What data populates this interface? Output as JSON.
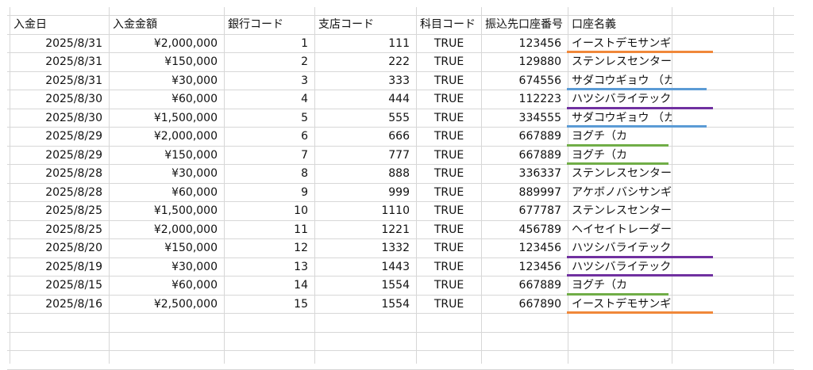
{
  "sheet": {
    "headers": [
      "入金日",
      "入金金額",
      "銀行コード",
      "支店コード",
      "科目コード",
      "振込先口座番号",
      "口座名義"
    ],
    "rows": [
      [
        "2025/8/31",
        "¥2,000,000",
        "1",
        "111",
        "TRUE",
        "123456",
        "イーストデモサンギョウ（カ"
      ],
      [
        "2025/8/31",
        "¥150,000",
        "2",
        "222",
        "TRUE",
        "129880",
        "ステンレスセンター （カ"
      ],
      [
        "2025/8/31",
        "¥30,000",
        "3",
        "333",
        "TRUE",
        "674556",
        "サダコウギョウ （カ"
      ],
      [
        "2025/8/30",
        "¥60,000",
        "4",
        "444",
        "TRUE",
        "112223",
        "ハツシバライテック（カ"
      ],
      [
        "2025/8/30",
        "¥1,500,000",
        "5",
        "555",
        "TRUE",
        "334555",
        "サダコウギョウ （カ"
      ],
      [
        "2025/8/29",
        "¥2,000,000",
        "6",
        "666",
        "TRUE",
        "667889",
        "ヨグチ（カ"
      ],
      [
        "2025/8/29",
        "¥150,000",
        "7",
        "777",
        "TRUE",
        "667889",
        "ヨグチ（カ"
      ],
      [
        "2025/8/28",
        "¥30,000",
        "8",
        "888",
        "TRUE",
        "336337",
        "ステンレスセンター （カ"
      ],
      [
        "2025/8/28",
        "¥60,000",
        "9",
        "999",
        "TRUE",
        "889997",
        "アケボノバシサンギョウ（カ"
      ],
      [
        "2025/8/25",
        "¥1,500,000",
        "10",
        "1110",
        "TRUE",
        "677787",
        "ステンレスセンター （カ"
      ],
      [
        "2025/8/25",
        "¥2,000,000",
        "11",
        "1221",
        "TRUE",
        "456789",
        "ヘイセイトレーダー（カ"
      ],
      [
        "2025/8/20",
        "¥150,000",
        "12",
        "1332",
        "TRUE",
        "123456",
        "ハツシバライテック（カ"
      ],
      [
        "2025/8/19",
        "¥30,000",
        "13",
        "1443",
        "TRUE",
        "123456",
        "ハツシバライテック（カ"
      ],
      [
        "2025/8/15",
        "¥60,000",
        "14",
        "1554",
        "TRUE",
        "667889",
        "ヨグチ（カ"
      ],
      [
        "2025/8/16",
        "¥2,500,000",
        "15",
        "1554",
        "TRUE",
        "667890",
        "イーストデモサンギョウ（カ"
      ]
    ],
    "underline_colors": [
      "#f0883a",
      null,
      "#5b9bd5",
      "#7030a0",
      "#5b9bd5",
      "#70ad47",
      "#70ad47",
      null,
      null,
      null,
      null,
      "#7030a0",
      "#7030a0",
      "#70ad47",
      "#f0883a"
    ]
  }
}
